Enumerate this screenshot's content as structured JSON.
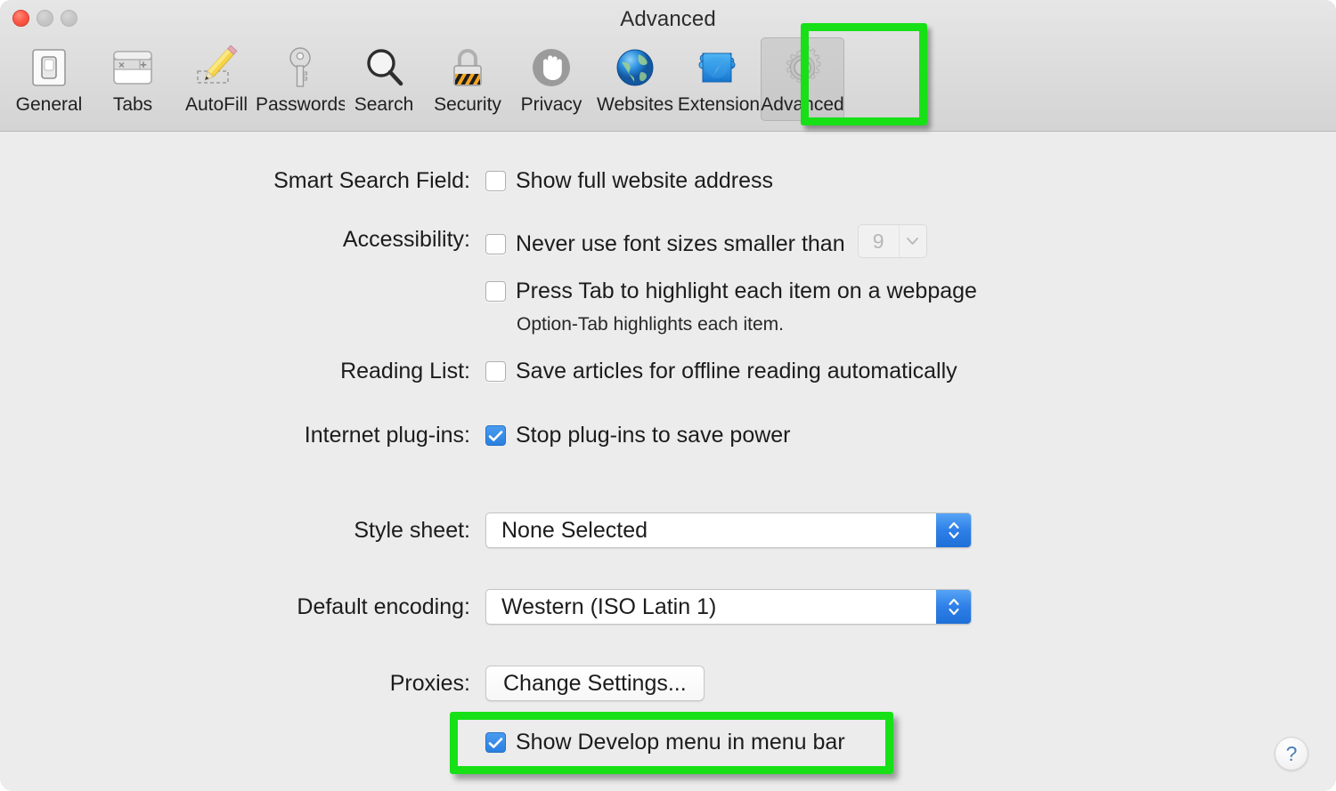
{
  "window": {
    "title": "Advanced",
    "controls": {
      "close": "close",
      "minimize": "minimize",
      "maximize": "maximize"
    }
  },
  "toolbar": {
    "tabs": [
      {
        "label": "General",
        "icon": "general-icon",
        "selected": false
      },
      {
        "label": "Tabs",
        "icon": "tabs-icon",
        "selected": false
      },
      {
        "label": "AutoFill",
        "icon": "autofill-icon",
        "selected": false
      },
      {
        "label": "Passwords",
        "icon": "key-icon",
        "selected": false
      },
      {
        "label": "Search",
        "icon": "magnifier-icon",
        "selected": false
      },
      {
        "label": "Security",
        "icon": "padlock-icon",
        "selected": false
      },
      {
        "label": "Privacy",
        "icon": "hand-icon",
        "selected": false
      },
      {
        "label": "Websites",
        "icon": "globe-icon",
        "selected": false
      },
      {
        "label": "Extension",
        "icon": "puzzle-icon",
        "selected": false
      },
      {
        "label": "Advanced",
        "icon": "gear-icon",
        "selected": true
      }
    ]
  },
  "settings": {
    "smart_search": {
      "label": "Smart Search Field:",
      "checkbox_label": "Show full website address",
      "checked": false
    },
    "accessibility": {
      "label": "Accessibility:",
      "font_size_label": "Never use font sizes smaller than",
      "font_size_checked": false,
      "font_size_value": "9",
      "tab_highlight_label": "Press Tab to highlight each item on a webpage",
      "tab_highlight_checked": false,
      "hint": "Option-Tab highlights each item."
    },
    "reading_list": {
      "label": "Reading List:",
      "checkbox_label": "Save articles for offline reading automatically",
      "checked": false
    },
    "internet_plugins": {
      "label": "Internet plug-ins:",
      "checkbox_label": "Stop plug-ins to save power",
      "checked": true
    },
    "style_sheet": {
      "label": "Style sheet:",
      "value": "None Selected"
    },
    "default_encoding": {
      "label": "Default encoding:",
      "value": "Western (ISO Latin 1)"
    },
    "proxies": {
      "label": "Proxies:",
      "button_label": "Change Settings..."
    },
    "develop_menu": {
      "checkbox_label": "Show Develop menu in menu bar",
      "checked": true
    }
  },
  "help": {
    "glyph": "?"
  },
  "annotations": {
    "highlight_color": "#17e017",
    "targets": [
      "advanced-tab",
      "show-develop-menu-checkbox"
    ]
  }
}
